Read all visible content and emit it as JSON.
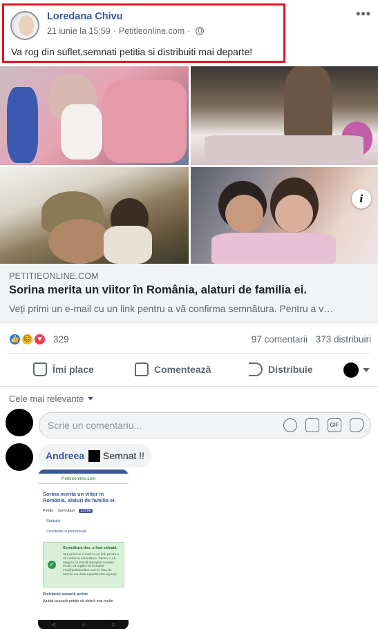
{
  "post": {
    "author": "Loredana Chivu",
    "date": "21 iunie la 15:59",
    "separator": "·",
    "source": "Petitieonline.com",
    "text": "Va rog din suflet,semnati petitia si distribuiti mai departe!",
    "more_icon": "more-horizontal-icon",
    "privacy_icon": "globe-icon"
  },
  "link_preview": {
    "domain": "PETITIEONLINE.COM",
    "title": "Sorina merita un viitor în România, alaturi de familia ei.",
    "description": "Veți primi un e-mail cu un link pentru a vă confirma semnătura. Pentru a v…",
    "info_icon": "info-icon"
  },
  "reactions": {
    "types": [
      "like",
      "sad",
      "love"
    ],
    "count": "329",
    "comments": "97 comentarii",
    "shares": "373 distribuiri"
  },
  "actions": {
    "like": "Îmi place",
    "comment": "Comentează",
    "share": "Distribuie"
  },
  "comments": {
    "sort_label": "Cele mai relevante",
    "input_placeholder": "Scrie un comentariu...",
    "items": [
      {
        "author": "Andreea",
        "text": "Semnat !!",
        "attachment": {
          "url": "Petitieonline.com",
          "title": "Sorina merita un viitor în România, alaturi de familia ei.",
          "tab_petition": "Petiție",
          "tab_signatures": "Semnături",
          "tab_count": "13196",
          "link_stats": "Statistici",
          "link_visibility": "Vizibilitate suplimentară",
          "success_title": "Semnătura dvs. a fost salvată.",
          "success_text": "Veți primi un e-mail cu un link pentru a vă confirma semnătura. Pentru a vă asigura că primiți mesajele noastre email, vă rugăm să includeți info@petitieonline.com în lista de adrese sau lista expeditorilor agreați.",
          "share_title": "Distribuiți această petiție",
          "share_sub": "Ajutați această petiție să obțină mai multe"
        }
      }
    ]
  }
}
